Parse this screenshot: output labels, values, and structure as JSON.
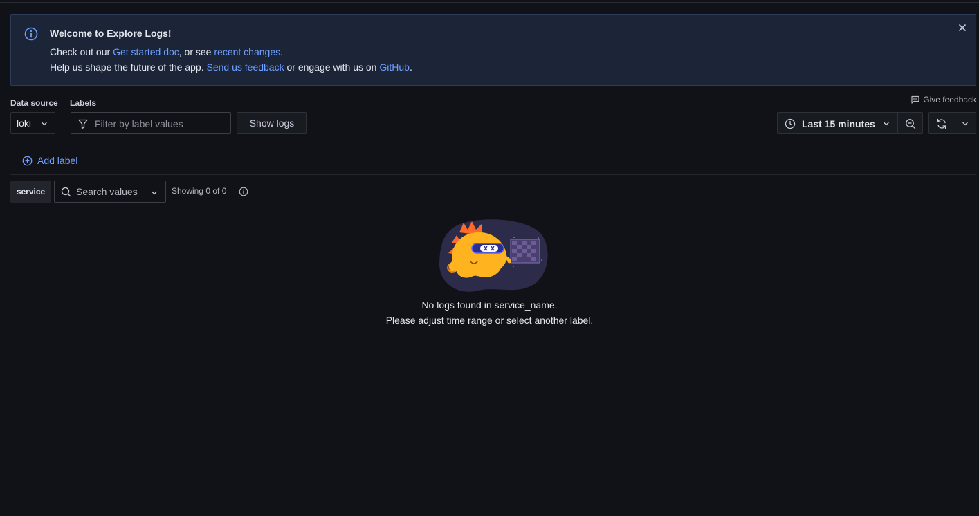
{
  "banner": {
    "title": "Welcome to Explore Logs!",
    "line1_prefix": "Check out our ",
    "line1_link1": "Get started doc",
    "line1_mid": ", or see ",
    "line1_link2": "recent changes",
    "line1_suffix": ".",
    "line2_prefix": "Help us shape the future of the app. ",
    "line2_link1": "Send us feedback",
    "line2_mid": " or engage with us on ",
    "line2_link2": "GitHub",
    "line2_suffix": "."
  },
  "controls": {
    "datasource_label": "Data source",
    "datasource_value": "loki",
    "labels_label": "Labels",
    "filter_placeholder": "Filter by label values",
    "show_logs": "Show logs",
    "give_feedback": "Give feedback",
    "time_range": "Last 15 minutes"
  },
  "add_label": "Add label",
  "service_tab": {
    "label": "service",
    "search_placeholder": "Search values",
    "showing": "Showing 0 of 0"
  },
  "empty_state": {
    "line1": "No logs found in service_name.",
    "line2": "Please adjust time range or select another label."
  },
  "icons": {
    "banner": "info-circle-icon",
    "close": "close-icon",
    "filter": "filter-icon",
    "feedback": "comment-icon",
    "clock": "clock-icon",
    "zoom": "zoom-out-icon",
    "refresh": "sync-icon",
    "add": "plus-circle-icon",
    "search": "search-icon",
    "chevron": "chevron-down-icon"
  },
  "colors": {
    "background": "#111217",
    "banner_bg": "#1b2537",
    "link": "#6e9fff",
    "text": "#e4e6ee"
  }
}
